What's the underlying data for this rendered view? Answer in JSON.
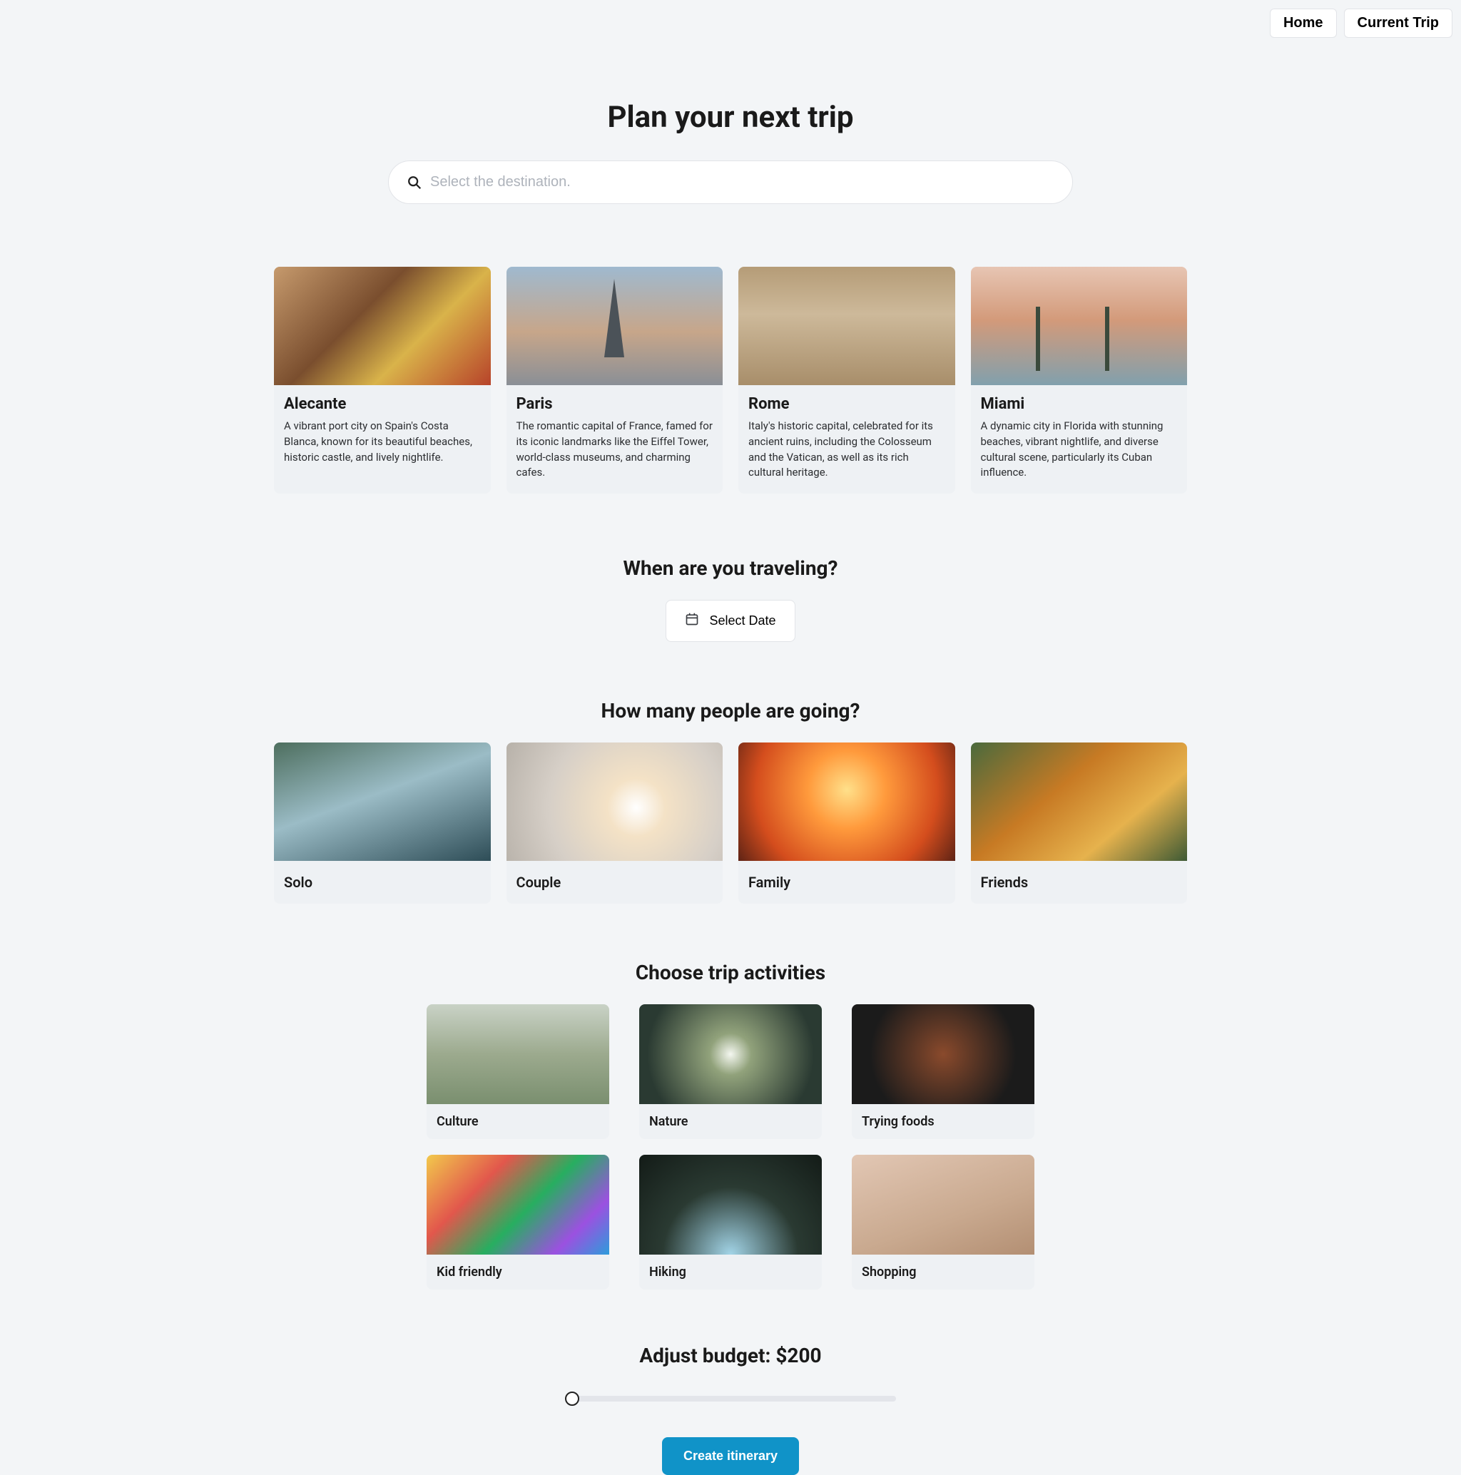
{
  "nav": {
    "home": "Home",
    "current_trip": "Current Trip"
  },
  "title": "Plan your next trip",
  "search": {
    "placeholder": "Select the destination."
  },
  "destinations": [
    {
      "name": "Alecante",
      "desc": "A vibrant port city on Spain's Costa Blanca, known for its beautiful beaches, historic castle, and lively nightlife.",
      "thumb_class": "g-alecante"
    },
    {
      "name": "Paris",
      "desc": "The romantic capital of France, famed for its iconic landmarks like the Eiffel Tower, world-class museums, and charming cafes.",
      "thumb_class": "g-paris"
    },
    {
      "name": "Rome",
      "desc": "Italy's historic capital, celebrated for its ancient ruins, including the Colosseum and the Vatican, as well as its rich cultural heritage.",
      "thumb_class": "g-rome"
    },
    {
      "name": "Miami",
      "desc": "A dynamic city in Florida with stunning beaches, vibrant nightlife, and diverse cultural scene, particularly its Cuban influence.",
      "thumb_class": "g-miami"
    }
  ],
  "date_section": {
    "title": "When are you traveling?",
    "cta": "Select Date"
  },
  "people_section": {
    "title": "How many people are going?",
    "options": [
      {
        "label": "Solo",
        "thumb_class": "g-solo"
      },
      {
        "label": "Couple",
        "thumb_class": "g-couple"
      },
      {
        "label": "Family",
        "thumb_class": "g-family"
      },
      {
        "label": "Friends",
        "thumb_class": "g-friends"
      }
    ]
  },
  "activities_section": {
    "title": "Choose trip activities",
    "options": [
      {
        "label": "Culture",
        "thumb_class": "g-culture"
      },
      {
        "label": "Nature",
        "thumb_class": "g-nature"
      },
      {
        "label": "Trying foods",
        "thumb_class": "g-foods"
      },
      {
        "label": "Kid friendly",
        "thumb_class": "g-kid"
      },
      {
        "label": "Hiking",
        "thumb_class": "g-hiking"
      },
      {
        "label": "Shopping",
        "thumb_class": "g-shopping"
      }
    ]
  },
  "budget": {
    "prefix": "Adjust budget: ",
    "amount": "$200",
    "value": 200,
    "min": 200,
    "max": 5000
  },
  "create_cta": "Create itinerary"
}
